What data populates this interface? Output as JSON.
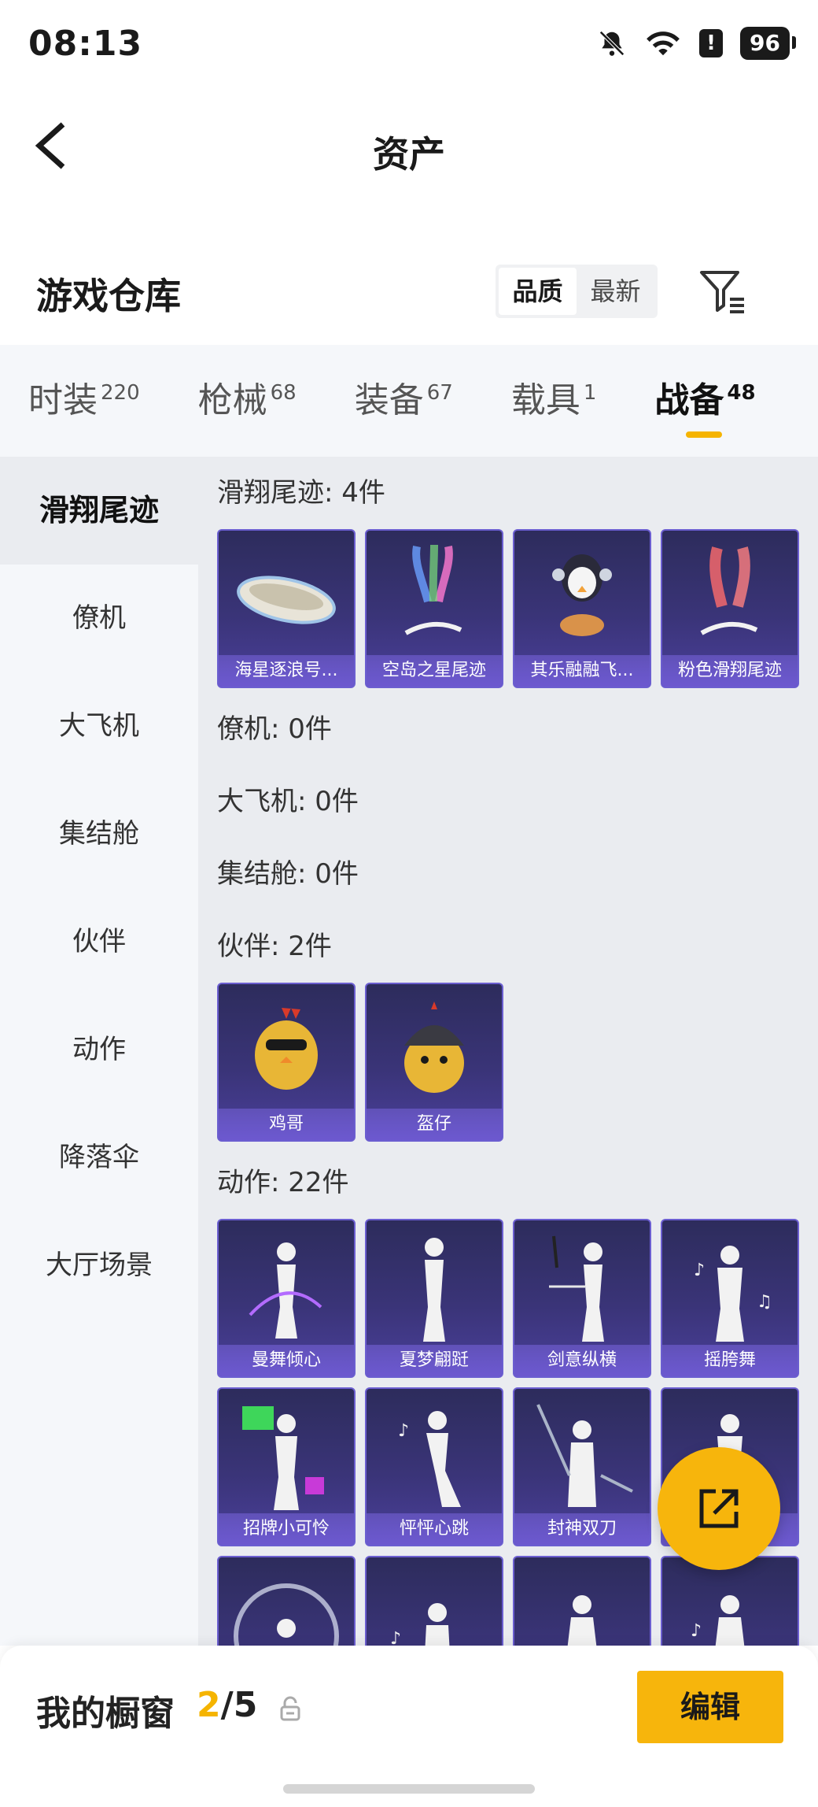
{
  "status_bar": {
    "time": "08:13",
    "battery": "96",
    "alert": "!"
  },
  "header": {
    "title": "资产"
  },
  "warehouse": {
    "title": "游戏仓库",
    "sort_options": [
      "品质",
      "最新"
    ],
    "active_sort": "品质"
  },
  "tabs": [
    {
      "label": "时装",
      "count": "220"
    },
    {
      "label": "枪械",
      "count": "68"
    },
    {
      "label": "装备",
      "count": "67"
    },
    {
      "label": "载具",
      "count": "1"
    },
    {
      "label": "战备",
      "count": "48"
    }
  ],
  "sidebar": {
    "items": [
      "滑翔尾迹",
      "僚机",
      "大飞机",
      "集结舱",
      "伙伴",
      "动作",
      "降落伞",
      "大厅场景"
    ]
  },
  "sections": {
    "glide": {
      "title": "滑翔尾迹: 4件",
      "items": [
        "海星逐浪号...",
        "空岛之星尾迹",
        "其乐融融飞...",
        "粉色滑翔尾迹"
      ]
    },
    "wingman": {
      "title": "僚机: 0件"
    },
    "plane": {
      "title": "大飞机: 0件"
    },
    "pod": {
      "title": "集结舱: 0件"
    },
    "partner": {
      "title": "伙伴: 2件",
      "items": [
        "鸡哥",
        "盔仔"
      ]
    },
    "emote": {
      "title": "动作: 22件",
      "items": [
        "曼舞倾心",
        "夏梦翩跹",
        "剑意纵横",
        "摇胯舞",
        "招牌小可怜",
        "怦怦心跳",
        "封神双刀",
        "",
        "",
        "",
        "",
        ""
      ]
    }
  },
  "bottom": {
    "showcase_label": "我的橱窗",
    "current": "2",
    "separator": "/",
    "total": "5",
    "edit_label": "编辑"
  },
  "colors": {
    "accent": "#f7b50c",
    "card_top": "#2d2c5c",
    "card_bottom": "#4a3f9a"
  },
  "icons": [
    "back-arrow-icon",
    "filter-icon",
    "share-icon",
    "lock-icon",
    "bell-off-icon",
    "wifi-icon"
  ]
}
